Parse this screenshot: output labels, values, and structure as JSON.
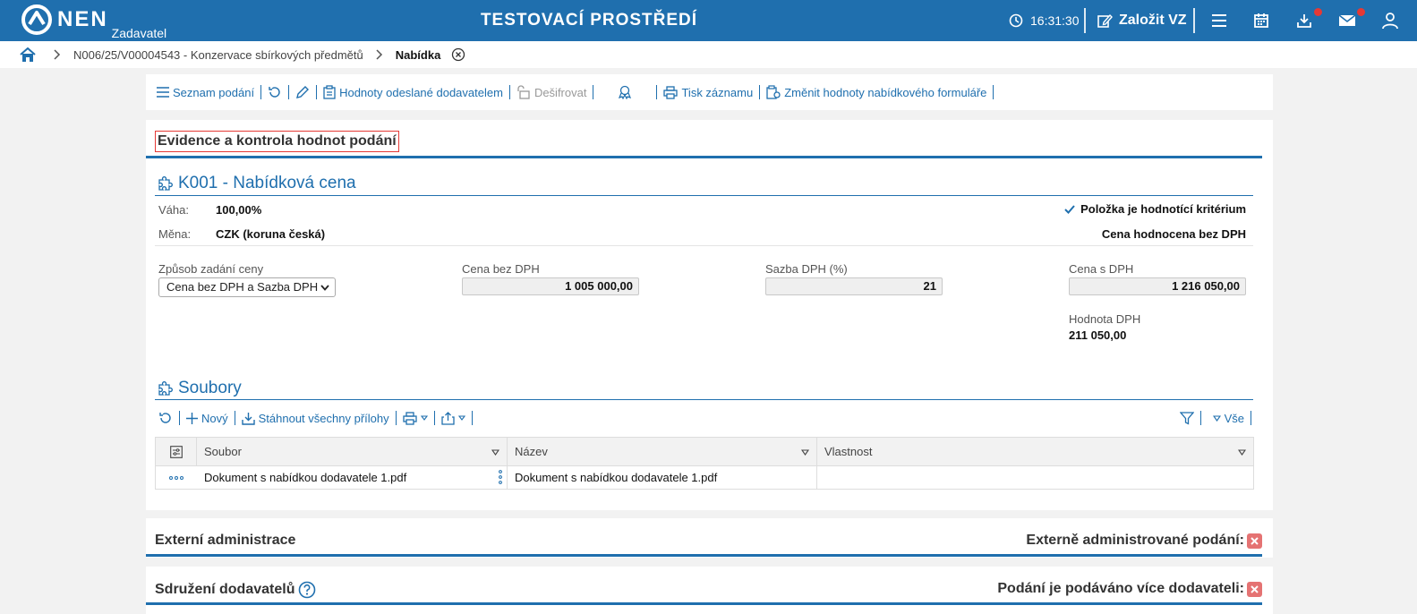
{
  "header": {
    "brand": "NEN",
    "role": "Zadavatel",
    "environment_title": "TESTOVACÍ PROSTŘEDÍ",
    "clock": "16:31:30",
    "create_vz_label": "Založit VZ"
  },
  "breadcrumb": {
    "item1": "N006/25/V00004543 - Konzervace sbírkových předmětů",
    "current": "Nabídka"
  },
  "toolbar": {
    "list": "Seznam podání",
    "supplier_values": "Hodnoty odeslané dodavatelem",
    "decrypt": "Dešifrovat",
    "print": "Tisk záznamu",
    "change_values": "Změnit hodnoty nabídkového formuláře"
  },
  "main": {
    "section_title": "Evidence a kontrola hodnot podání",
    "criterion_title": "K001 - Nabídková cena",
    "weight_label": "Váha:",
    "weight_value": "100,00%",
    "currency_label": "Měna:",
    "currency_value": "CZK (koruna česká)",
    "criterion_flag": "Položka je hodnotící kritérium",
    "price_note": "Cena hodnocena bez DPH",
    "price_mode_label": "Způsob zadání ceny",
    "price_mode_value": "Cena bez DPH a Sazba DPH",
    "price_no_vat_label": "Cena bez DPH",
    "price_no_vat_value": "1 005 000,00",
    "vat_rate_label": "Sazba DPH (%)",
    "vat_rate_value": "21",
    "price_vat_label": "Cena s DPH",
    "price_vat_value": "1 216 050,00",
    "vat_value_label": "Hodnota DPH",
    "vat_value": "211 050,00"
  },
  "files": {
    "title": "Soubory",
    "new_label": "Nový",
    "download_all_label": "Stáhnout všechny přílohy",
    "filter_all_label": "Vše",
    "columns": [
      "Soubor",
      "Název",
      "Vlastnost"
    ],
    "rows": [
      {
        "file": "Dokument s nabídkou dodavatele 1.pdf",
        "name": "Dokument s nabídkou dodavatele 1.pdf",
        "property": ""
      }
    ]
  },
  "external": {
    "title": "Externí administrace",
    "right_label": "Externě administrované podání:"
  },
  "consortium": {
    "title": "Sdružení dodavatelů",
    "right_label": "Podání je podáváno více dodavateli:"
  },
  "colors": {
    "primary": "#1f6fae",
    "alert_red": "#e53935",
    "x_badge": "#e57373"
  }
}
